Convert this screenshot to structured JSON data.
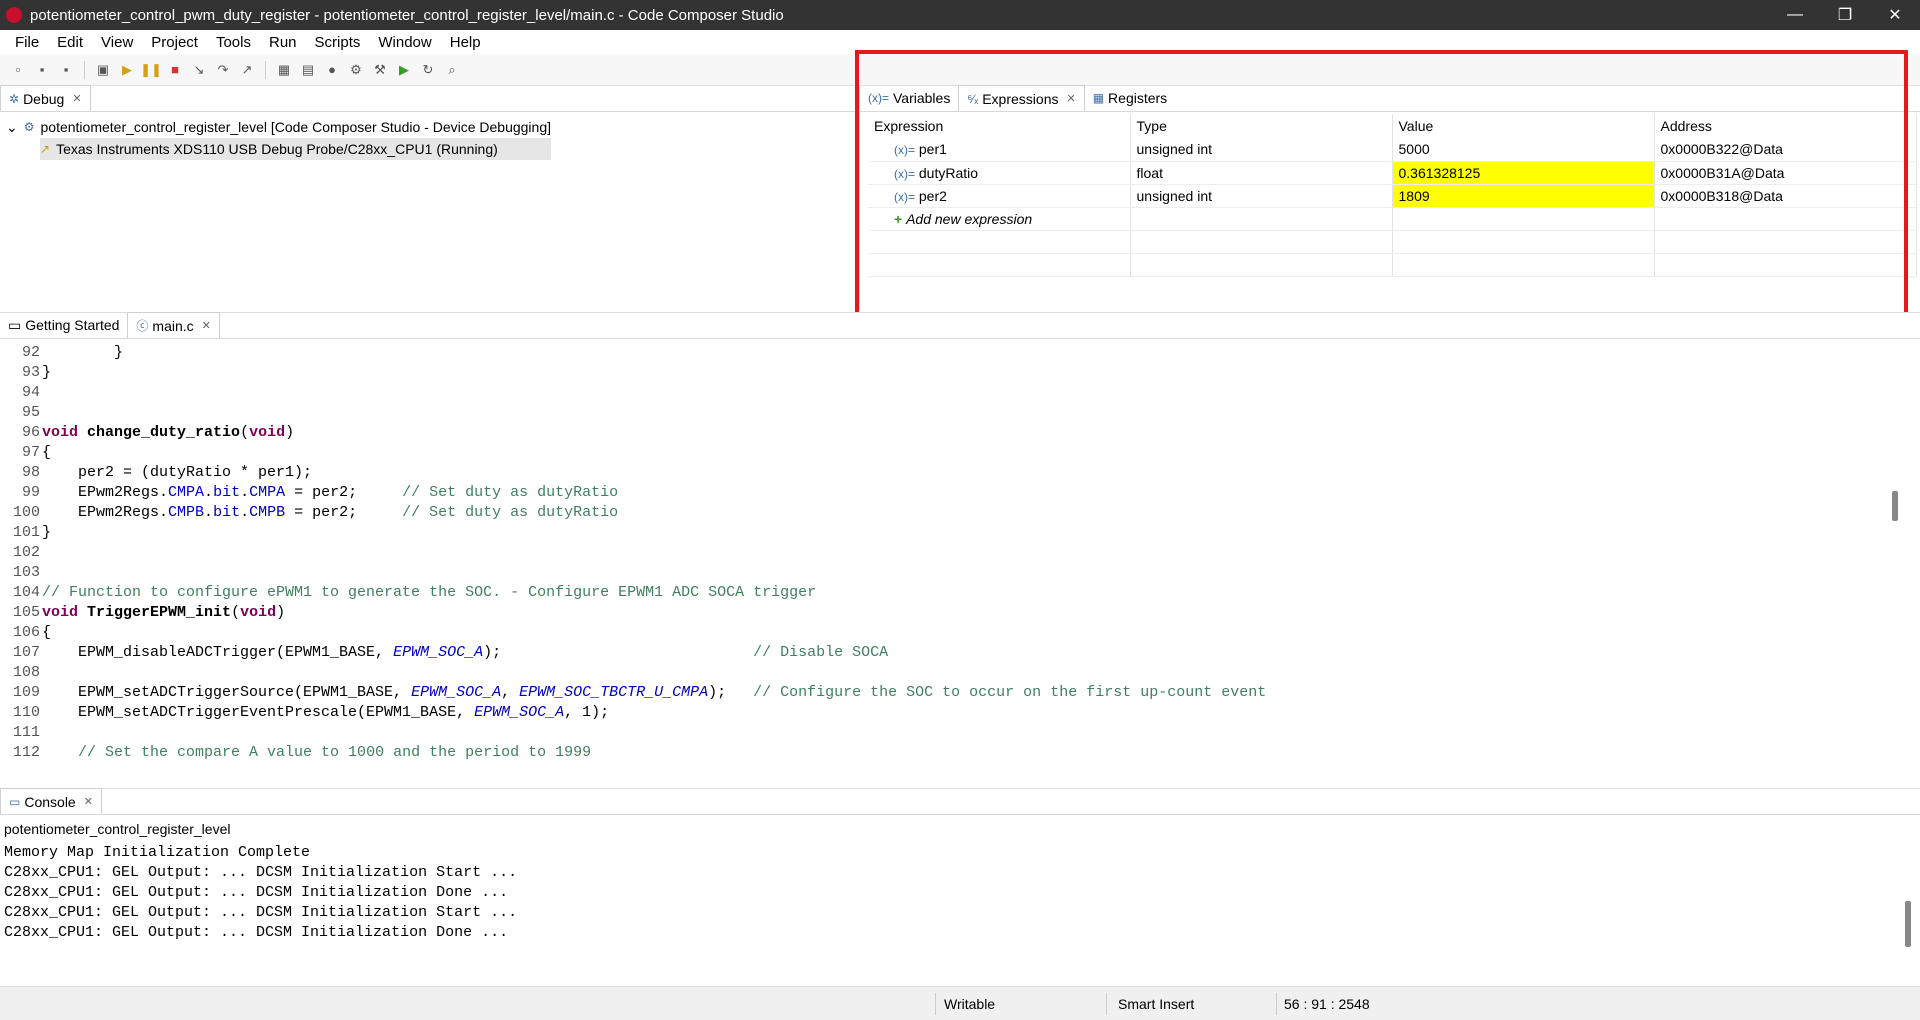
{
  "window": {
    "title": "potentiometer_control_pwm_duty_register - potentiometer_control_register_level/main.c - Code Composer Studio",
    "controls": [
      "—",
      "❐",
      "✕"
    ]
  },
  "menu": [
    "File",
    "Edit",
    "View",
    "Project",
    "Tools",
    "Run",
    "Scripts",
    "Window",
    "Help"
  ],
  "debug_panel": {
    "tab": "Debug",
    "tree": [
      "potentiometer_control_register_level [Code Composer Studio - Device Debugging]",
      "Texas Instruments XDS110 USB Debug Probe/C28xx_CPU1 (Running)"
    ]
  },
  "expressions_panel": {
    "tabs": [
      "Variables",
      "Expressions",
      "Registers"
    ],
    "columns": [
      "Expression",
      "Type",
      "Value",
      "Address"
    ],
    "rows": [
      {
        "name": "per1",
        "type": "unsigned int",
        "value": "5000",
        "address": "0x0000B322@Data",
        "highlight": false
      },
      {
        "name": "dutyRatio",
        "type": "float",
        "value": "0.361328125",
        "address": "0x0000B31A@Data",
        "highlight": true
      },
      {
        "name": "per2",
        "type": "unsigned int",
        "value": "1809",
        "address": "0x0000B318@Data",
        "highlight": true
      }
    ],
    "add_label": "Add new expression",
    "highlight_color": "#ffff00",
    "annotation_color": "#e3191c"
  },
  "editor": {
    "tabs": [
      "Getting Started",
      "main.c"
    ],
    "lines": [
      {
        "n": "92",
        "t": "        }"
      },
      {
        "n": "93",
        "t": "}"
      },
      {
        "n": "94",
        "t": ""
      },
      {
        "n": "95",
        "t": ""
      },
      {
        "n": "96",
        "t": "void change_duty_ratio(void)"
      },
      {
        "n": "97",
        "t": "{"
      },
      {
        "n": "98",
        "t": "    per2 = (dutyRatio * per1);"
      },
      {
        "n": "99",
        "t": "    EPwm2Regs.CMPA.bit.CMPA = per2;     // Set duty as dutyRatio"
      },
      {
        "n": "100",
        "t": "    EPwm2Regs.CMPB.bit.CMPB = per2;     // Set duty as dutyRatio"
      },
      {
        "n": "101",
        "t": "}"
      },
      {
        "n": "102",
        "t": ""
      },
      {
        "n": "103",
        "t": ""
      },
      {
        "n": "104",
        "t": "// Function to configure ePWM1 to generate the SOC. - Configure EPWM1 ADC SOCA trigger"
      },
      {
        "n": "105",
        "t": "void TriggerEPWM_init(void)"
      },
      {
        "n": "106",
        "t": "{"
      },
      {
        "n": "107",
        "t": "    EPWM_disableADCTrigger(EPWM1_BASE, EPWM_SOC_A);                            // Disable SOCA"
      },
      {
        "n": "108",
        "t": ""
      },
      {
        "n": "109",
        "t": "    EPWM_setADCTriggerSource(EPWM1_BASE, EPWM_SOC_A, EPWM_SOC_TBCTR_U_CMPA);   // Configure the SOC to occur on the first up-count event"
      },
      {
        "n": "110",
        "t": "    EPWM_setADCTriggerEventPrescale(EPWM1_BASE, EPWM_SOC_A, 1);"
      },
      {
        "n": "111",
        "t": ""
      },
      {
        "n": "112",
        "t": "    // Set the compare A value to 1000 and the period to 1999"
      }
    ]
  },
  "console": {
    "tab": "Console",
    "project": "potentiometer_control_register_level",
    "lines": [
      "Memory Map Initialization Complete",
      "C28xx_CPU1: GEL Output: ... DCSM Initialization Start ...",
      "C28xx_CPU1: GEL Output: ... DCSM Initialization Done ...",
      "C28xx_CPU1: GEL Output: ... DCSM Initialization Start ...",
      "C28xx_CPU1: GEL Output: ... DCSM Initialization Done ..."
    ]
  },
  "status": {
    "writable": "Writable",
    "insert_mode": "Smart Insert",
    "position": "56 : 91 : 2548"
  }
}
